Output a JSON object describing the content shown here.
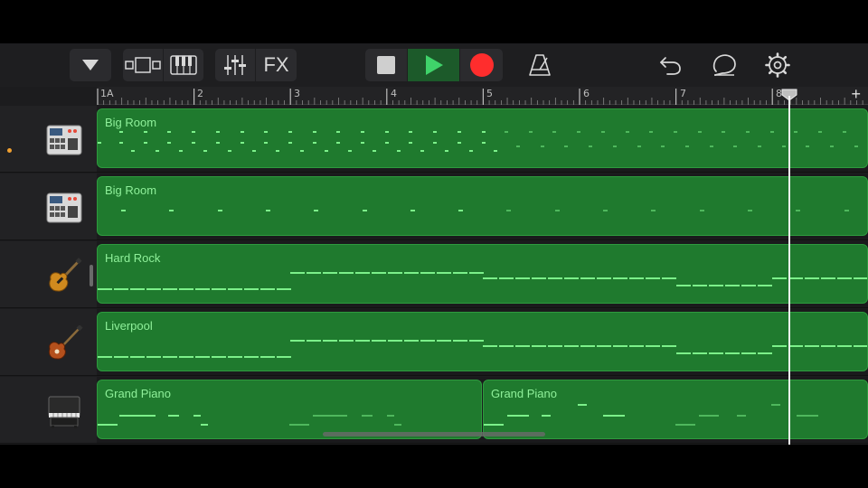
{
  "toolbar": {
    "fx_label": "FX",
    "colors": {
      "play": "#3fd36a",
      "record": "#ff2d2d",
      "play_bg": "#1c5a2a"
    }
  },
  "ruler": {
    "bars": [
      "1A",
      "2",
      "3",
      "4",
      "5",
      "6",
      "7",
      "8"
    ],
    "add_label": "+"
  },
  "tracks": [
    {
      "icon": "drum-machine-icon",
      "regions": [
        {
          "label": "Big Room"
        }
      ]
    },
    {
      "icon": "drum-machine-icon",
      "regions": [
        {
          "label": "Big Room"
        }
      ]
    },
    {
      "icon": "electric-guitar-icon",
      "regions": [
        {
          "label": "Hard Rock"
        }
      ]
    },
    {
      "icon": "bass-guitar-icon",
      "regions": [
        {
          "label": "Liverpool"
        }
      ]
    },
    {
      "icon": "upright-piano-icon",
      "regions": [
        {
          "label": "Grand Piano"
        },
        {
          "label": "Grand Piano"
        }
      ]
    }
  ]
}
